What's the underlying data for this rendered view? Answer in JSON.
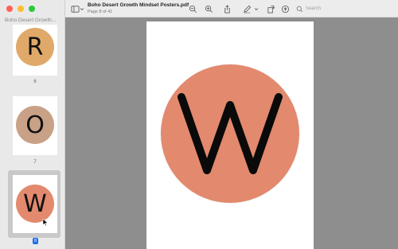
{
  "window": {
    "title": "Boho Desert Growth Mindset Posters.pdf",
    "subtitle": "Page 8 of 41"
  },
  "sidebar": {
    "doc_name": "Boho Desert Growth...",
    "thumbnails": [
      {
        "letter": "R",
        "page": "6",
        "color": "#e0a96a",
        "selected": false
      },
      {
        "letter": "O",
        "page": "7",
        "color": "#c9a187",
        "selected": false
      },
      {
        "letter": "W",
        "page": "8",
        "color": "#e2896e",
        "selected": true
      }
    ]
  },
  "toolbar": {
    "search_placeholder": "Search",
    "icons": [
      "sidebar-toggle-icon",
      "zoom-out-icon",
      "zoom-in-icon",
      "share-icon",
      "markup-icon",
      "chevron-down-icon",
      "rotate-icon",
      "annotate-icon",
      "search-icon"
    ]
  },
  "document": {
    "letter": "W",
    "circle_color": "#e2896e"
  },
  "colors": {
    "toolbar_bg": "#ececec",
    "sidebar_bg": "#e9e9e9",
    "doc_bg": "#8e8e8e",
    "selection_blue": "#1a6ef0"
  }
}
